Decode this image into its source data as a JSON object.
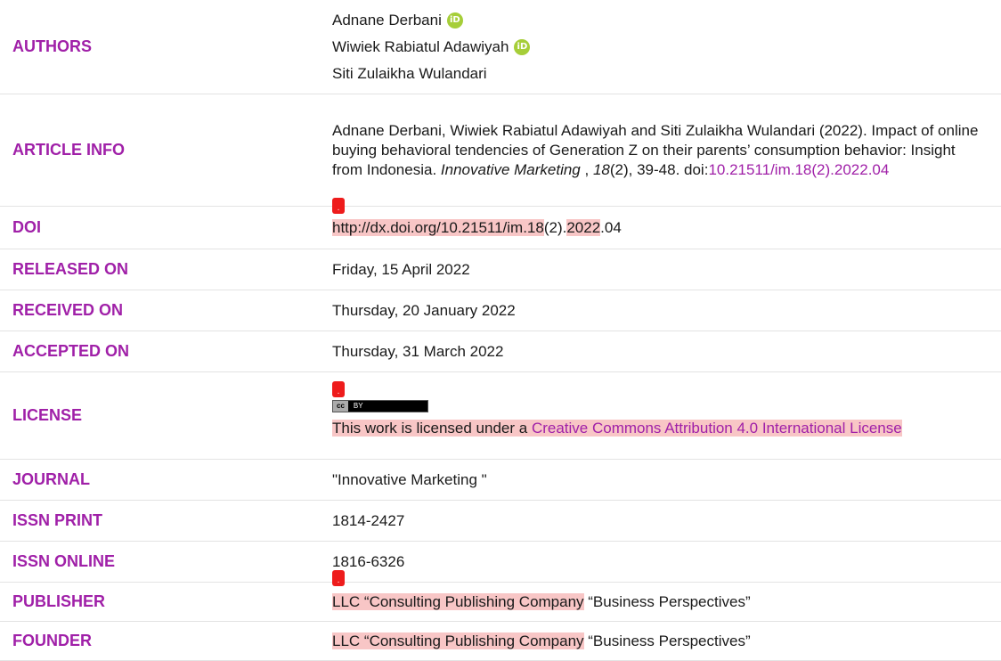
{
  "rows": {
    "authors": {
      "label": "AUTHORS",
      "names": [
        "Adnane Derbani",
        "Wiwiek Rabiatul Adawiyah",
        "Siti Zulaikha Wulandari"
      ],
      "orcid_icon": "iD"
    },
    "article_info": {
      "label": "ARTICLE INFO",
      "text_pre": "Adnane Derbani, Wiwiek Rabiatul Adawiyah and Siti Zulaikha Wulandari (2022). Impact of online buying behavioral tendencies of Generation Z on their parents’ consumption behavior: Insight from Indonesia. ",
      "journal_italic": "Innovative Marketing",
      "text_mid": " , ",
      "volume_italic": "18",
      "text_post": "(2), 39-48. doi:",
      "doi_link": "10.21511/im.18(2).2022.04"
    },
    "doi": {
      "label": "DOI",
      "parts": [
        "http://dx.doi.org/10.21511/im.18",
        "(2).",
        "2022",
        ".04"
      ]
    },
    "released": {
      "label": "RELEASED ON",
      "value": "Friday, 15 April 2022"
    },
    "received": {
      "label": "RECEIVED ON",
      "value": "Thursday, 20 January 2022"
    },
    "accepted": {
      "label": "ACCEPTED ON",
      "value": "Thursday, 31 March 2022"
    },
    "license": {
      "label": "LICENSE",
      "badge_cc": "cc",
      "badge_by": "BY",
      "text": "This work is licensed under a ",
      "link": "Creative Commons Attribution 4.0 International License"
    },
    "journal": {
      "label": "JOURNAL",
      "value": "\"Innovative Marketing \""
    },
    "issn_print": {
      "label": "ISSN PRINT",
      "value": "1814-2427"
    },
    "issn_online": {
      "label": "ISSN ONLINE",
      "value": "1816-6326"
    },
    "publisher": {
      "label": "PUBLISHER",
      "highlighted": "LLC “Consulting Publishing Company",
      "rest": " “Business Perspectives”"
    },
    "founder": {
      "label": "FOUNDER",
      "highlighted": "LLC “Consulting Publishing Company",
      "rest": " “Business Perspectives”"
    }
  },
  "marker_glyph": "."
}
